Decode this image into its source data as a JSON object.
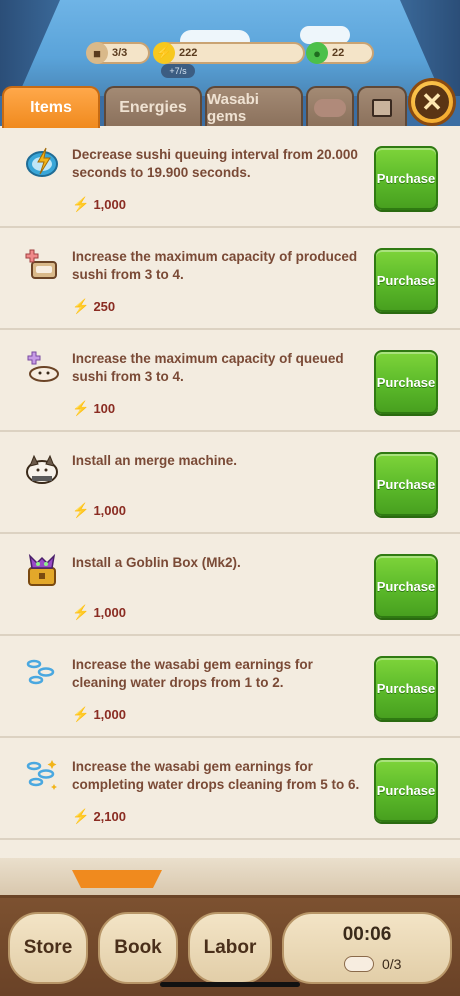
{
  "resources": {
    "sushi": "3/3",
    "energy": "222",
    "energy_rate": "+7/s",
    "gems": "22"
  },
  "tabs": [
    {
      "label": "Items"
    },
    {
      "label": "Energies"
    },
    {
      "label": "Wasabi gems"
    }
  ],
  "items": [
    {
      "desc": "Decrease sushi queuing interval from 20.000 seconds to 19.900 seconds.",
      "cost": "1,000",
      "button": "Purchase",
      "icon": "clock-icon"
    },
    {
      "desc": "Increase the maximum capacity of produced sushi from 3 to 4.",
      "cost": "250",
      "button": "Purchase",
      "icon": "sushi-plus-icon"
    },
    {
      "desc": "Increase the maximum capacity of queued sushi from 3 to 4.",
      "cost": "100",
      "button": "Purchase",
      "icon": "queue-plus-icon"
    },
    {
      "desc": "Install an merge machine.",
      "cost": "1,000",
      "button": "Purchase",
      "icon": "merge-machine-icon"
    },
    {
      "desc": "Install a Goblin Box (Mk2).",
      "cost": "1,000",
      "button": "Purchase",
      "icon": "goblin-box-icon"
    },
    {
      "desc": "Increase the wasabi gem earnings for cleaning water drops from 1 to 2.",
      "cost": "1,000",
      "button": "Purchase",
      "icon": "water-drops-icon"
    },
    {
      "desc": "Increase the wasabi gem earnings for completing water drops cleaning from 5 to 6.",
      "cost": "2,100",
      "button": "Purchase",
      "icon": "water-drops-sparkle-icon"
    }
  ],
  "nav": {
    "store": "Store",
    "book": "Book",
    "labor": "Labor",
    "timer": "00:06",
    "count": "0/3"
  },
  "colors": {
    "purchase": "#5bb92a",
    "active_tab": "#f08a1e",
    "cost": "#8a2c22"
  }
}
